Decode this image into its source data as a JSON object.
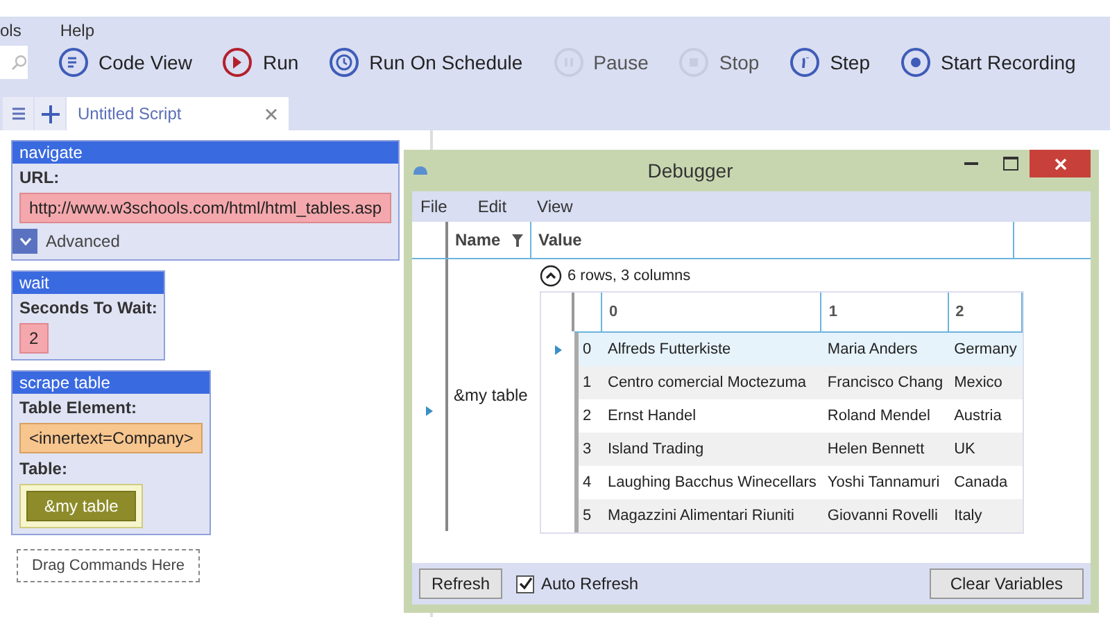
{
  "menu": [
    "ols",
    "Help"
  ],
  "toolbar": [
    {
      "label": "Code View",
      "kind": "code",
      "disabled": false
    },
    {
      "label": "Run",
      "kind": "run",
      "disabled": false
    },
    {
      "label": "Run On Schedule",
      "kind": "schedule",
      "disabled": false
    },
    {
      "label": "Pause",
      "kind": "pause",
      "disabled": true
    },
    {
      "label": "Stop",
      "kind": "stop",
      "disabled": true
    },
    {
      "label": "Step",
      "kind": "step",
      "disabled": false
    },
    {
      "label": "Start Recording",
      "kind": "record",
      "disabled": false
    }
  ],
  "tabs": [
    {
      "label": "Untitled Script",
      "selected": true
    }
  ],
  "commands": [
    {
      "title": "navigate",
      "fields": [
        {
          "label": "URL:",
          "value": "http://www.w3schools.com/html/html_tables.asp",
          "kind": "text"
        }
      ],
      "advanced": {
        "label": "Advanced",
        "expanded": false
      }
    },
    {
      "title": "wait",
      "fields": [
        {
          "label": "Seconds To Wait:",
          "value": "2",
          "kind": "text"
        }
      ]
    },
    {
      "title": "scrape table",
      "fields": [
        {
          "label": "Table Element:",
          "value": "<innertext=Company>",
          "kind": "element"
        },
        {
          "label": "Table:",
          "value": "&my table",
          "kind": "variable"
        }
      ]
    }
  ],
  "drop_zone": "Drag Commands Here",
  "debugger": {
    "title": "Debugger",
    "menu": [
      "File",
      "Edit",
      "View"
    ],
    "columns": [
      "Name",
      "Value"
    ],
    "variable": {
      "name": "&my table",
      "summary": "6 rows, 3 columns",
      "expanded": true,
      "table": {
        "columns": [
          "0",
          "1",
          "2"
        ],
        "rows": [
          {
            "index": "0",
            "cells": [
              "Alfreds Futterkiste",
              "Maria Anders",
              "Germany"
            ],
            "selected": true
          },
          {
            "index": "1",
            "cells": [
              "Centro comercial Moctezuma",
              "Francisco Chang",
              "Mexico"
            ],
            "selected": false
          },
          {
            "index": "2",
            "cells": [
              "Ernst Handel",
              "Roland Mendel",
              "Austria"
            ],
            "selected": false
          },
          {
            "index": "3",
            "cells": [
              "Island Trading",
              "Helen Bennett",
              "UK"
            ],
            "selected": false
          },
          {
            "index": "4",
            "cells": [
              "Laughing Bacchus Winecellars",
              "Yoshi Tannamuri",
              "Canada"
            ],
            "selected": false
          },
          {
            "index": "5",
            "cells": [
              "Magazzini Alimentari Riuniti",
              "Giovanni Rovelli",
              "Italy"
            ],
            "selected": false
          }
        ]
      }
    },
    "refresh_button": "Refresh",
    "auto_refresh": {
      "label": "Auto Refresh",
      "checked": true
    },
    "clear_button": "Clear Variables"
  }
}
